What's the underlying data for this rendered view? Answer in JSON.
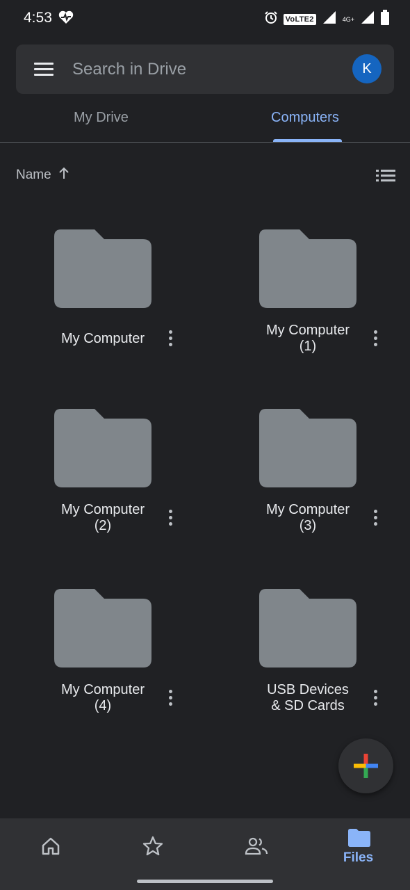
{
  "status_bar": {
    "time": "4:53",
    "network_badge": "VoLTE2",
    "signal_badge": "4G+"
  },
  "search": {
    "placeholder": "Search in Drive",
    "avatar_letter": "K"
  },
  "tabs": [
    {
      "label": "My Drive",
      "selected": false
    },
    {
      "label": "Computers",
      "selected": true
    }
  ],
  "sort": {
    "label": "Name",
    "direction_icon": "arrow-up-icon"
  },
  "items": [
    {
      "label": "My Computer"
    },
    {
      "label": "My Computer\n(1)"
    },
    {
      "label": "My Computer\n(2)"
    },
    {
      "label": "My Computer\n(3)"
    },
    {
      "label": "My Computer\n(4)"
    },
    {
      "label": "USB Devices\n& SD Cards"
    }
  ],
  "bottom_nav": [
    {
      "icon": "home-icon",
      "label": ""
    },
    {
      "icon": "star-icon",
      "label": ""
    },
    {
      "icon": "shared-icon",
      "label": ""
    },
    {
      "icon": "folder-icon",
      "label": "Files",
      "selected": true
    }
  ],
  "colors": {
    "accent": "#8ab4f8",
    "background": "#202124",
    "surface": "#303134",
    "folder": "#80868b",
    "avatar": "#1565c0"
  }
}
